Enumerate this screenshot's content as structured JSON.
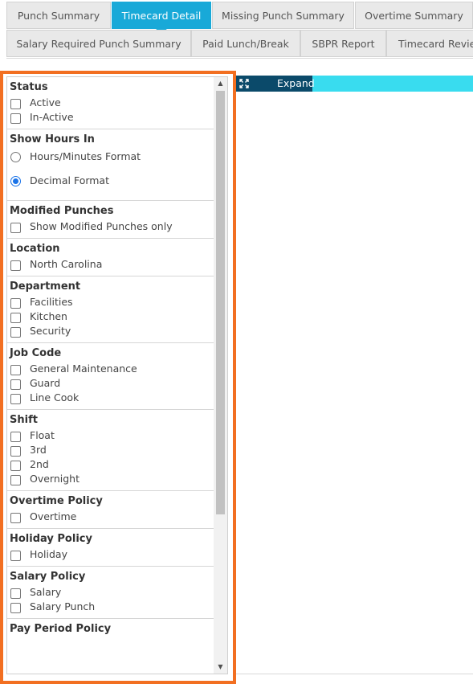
{
  "tabs_row1": [
    {
      "label": "Punch Summary",
      "active": false
    },
    {
      "label": "Timecard Detail",
      "active": true
    },
    {
      "label": "Missing Punch Summary",
      "active": false
    },
    {
      "label": "Overtime Summary",
      "active": false
    }
  ],
  "tabs_row2": [
    {
      "label": "Salary Required Punch Summary"
    },
    {
      "label": "Paid Lunch/Break"
    },
    {
      "label": "SBPR Report"
    },
    {
      "label": "Timecard Revie"
    }
  ],
  "expand": {
    "label": "Expand",
    "icon": "expand-arrows-icon"
  },
  "filters": {
    "status": {
      "title": "Status",
      "options": [
        "Active",
        "In-Active"
      ]
    },
    "hours": {
      "title": "Show Hours In",
      "options": [
        "Hours/Minutes Format",
        "Decimal Format"
      ],
      "selected": "Decimal Format"
    },
    "modified": {
      "title": "Modified Punches",
      "options": [
        "Show Modified Punches only"
      ]
    },
    "location": {
      "title": "Location",
      "options": [
        "North Carolina"
      ]
    },
    "department": {
      "title": "Department",
      "options": [
        "Facilities",
        "Kitchen",
        "Security"
      ]
    },
    "job_code": {
      "title": "Job Code",
      "options": [
        "General Maintenance",
        "Guard",
        "Line Cook"
      ]
    },
    "shift": {
      "title": "Shift",
      "options": [
        "Float",
        "3rd",
        "2nd",
        "Overnight"
      ]
    },
    "overtime_policy": {
      "title": "Overtime Policy",
      "options": [
        "Overtime"
      ]
    },
    "holiday_policy": {
      "title": "Holiday Policy",
      "options": [
        "Holiday"
      ]
    },
    "salary_policy": {
      "title": "Salary Policy",
      "options": [
        "Salary",
        "Salary Punch"
      ]
    },
    "pay_period_policy": {
      "title": "Pay Period Policy"
    }
  },
  "colors": {
    "active_tab": "#18a9d8",
    "highlight": "#f26f21",
    "expand_button": "#0b4a6a",
    "expand_bar": "#39dcef"
  }
}
